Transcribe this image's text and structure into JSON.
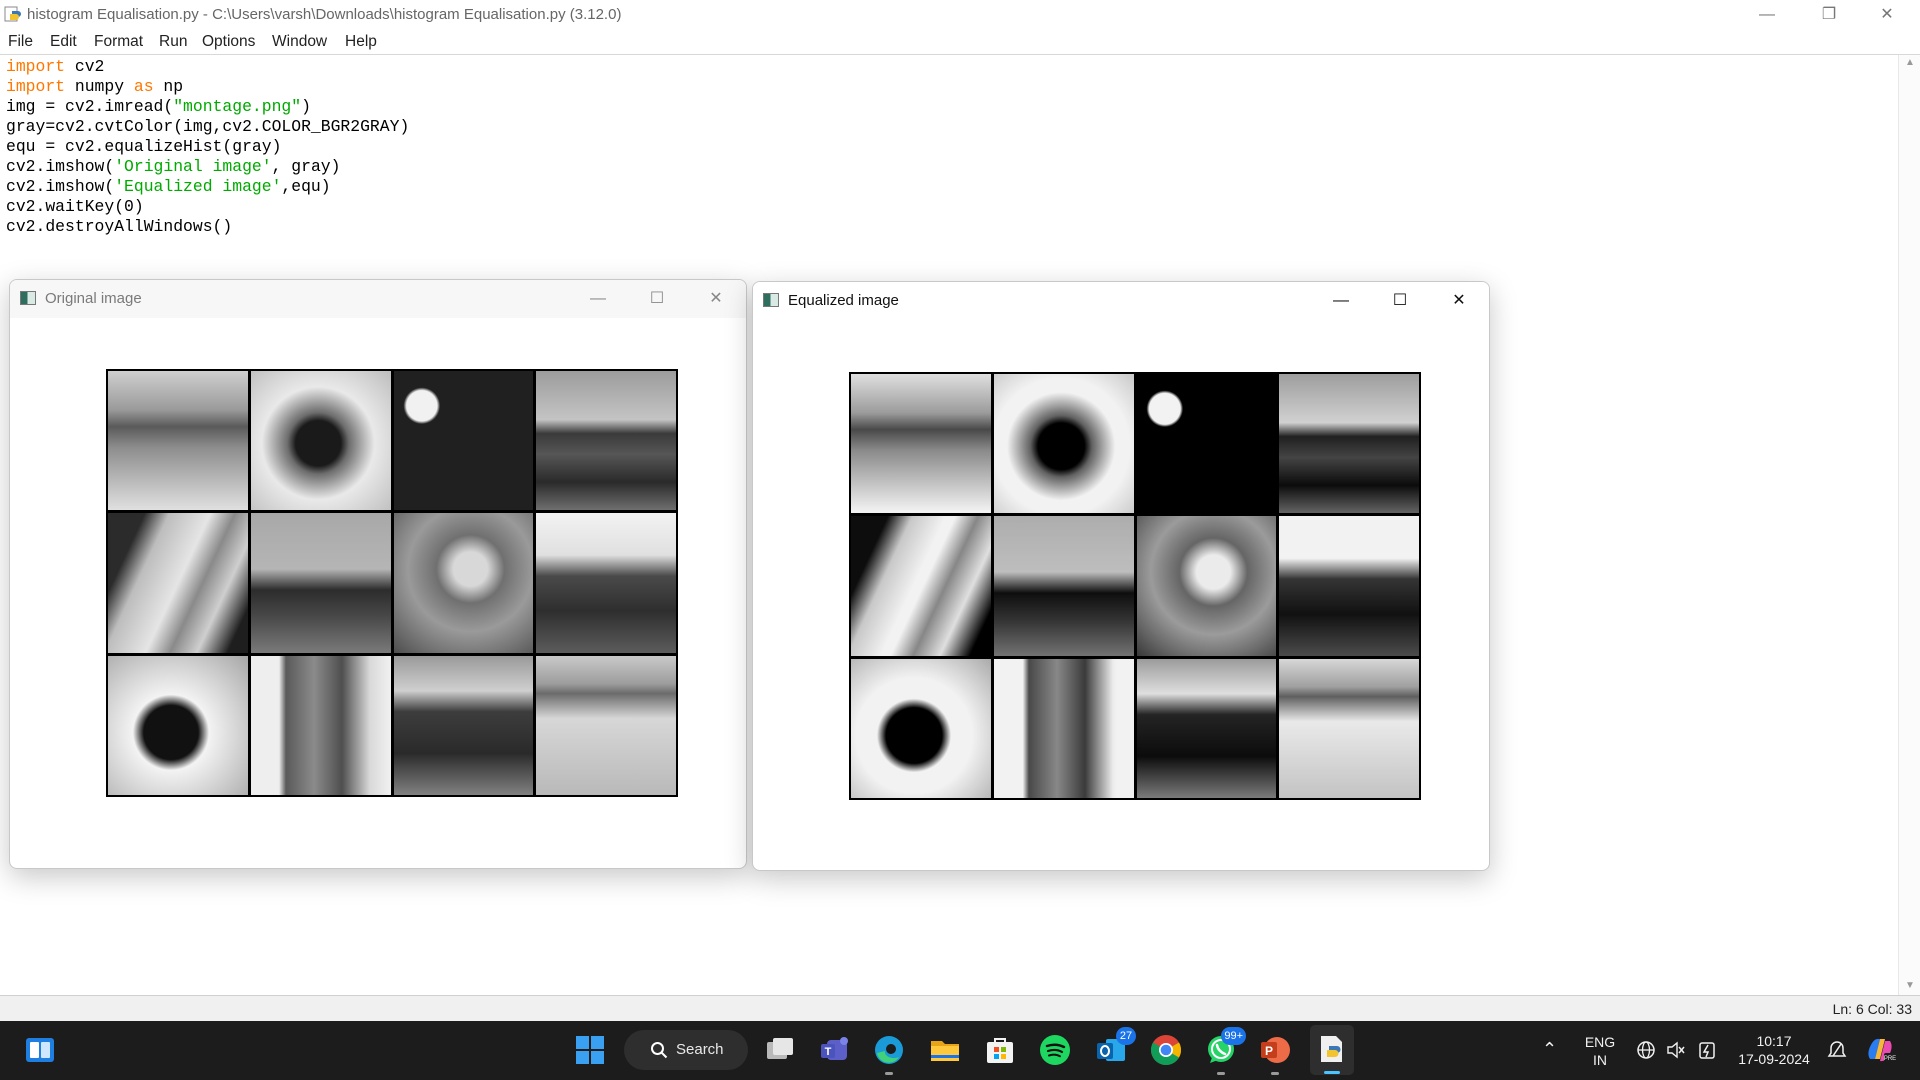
{
  "editor": {
    "title": "histogram Equalisation.py - C:\\Users\\varsh\\Downloads\\histogram Equalisation.py (3.12.0)",
    "menu": [
      "File",
      "Edit",
      "Format",
      "Run",
      "Options",
      "Window",
      "Help"
    ],
    "code_lines": [
      [
        {
          "t": "import",
          "c": "kw"
        },
        {
          "t": " cv2"
        }
      ],
      [
        {
          "t": "import",
          "c": "kw"
        },
        {
          "t": " numpy "
        },
        {
          "t": "as",
          "c": "kw"
        },
        {
          "t": " np"
        }
      ],
      [
        {
          "t": "img = cv2.imread("
        },
        {
          "t": "\"montage.png\"",
          "c": "str"
        },
        {
          "t": ")"
        }
      ],
      [
        {
          "t": "gray=cv2.cvtColor(img,cv2.COLOR_BGR2GRAY)"
        }
      ],
      [
        {
          "t": "equ = cv2.equalizeHist(gray)"
        }
      ],
      [
        {
          "t": "cv2.imshow("
        },
        {
          "t": "'Original image'",
          "c": "str"
        },
        {
          "t": ", gray)"
        }
      ],
      [
        {
          "t": "cv2.imshow("
        },
        {
          "t": "'Equalized image'",
          "c": "str"
        },
        {
          "t": ",equ)"
        }
      ],
      [
        {
          "t": "cv2.waitKey(0)"
        }
      ],
      [
        {
          "t": "cv2.destroyAllWindows()"
        }
      ]
    ],
    "status": "Ln: 6   Col: 33"
  },
  "windows": {
    "original": {
      "title": "Original image"
    },
    "equalized": {
      "title": "Equalized image"
    }
  },
  "taskbar": {
    "search_label": "Search",
    "badges": {
      "outlook": "27",
      "whatsapp": "99+"
    },
    "tray": {
      "lang_line1": "ENG",
      "lang_line2": "IN",
      "time": "10:17",
      "date": "17-09-2024"
    }
  },
  "colors": {
    "keyword": "#ff7700",
    "string": "#00aa00",
    "taskbar": "#1c1c1c",
    "badge": "#1a73e8"
  }
}
